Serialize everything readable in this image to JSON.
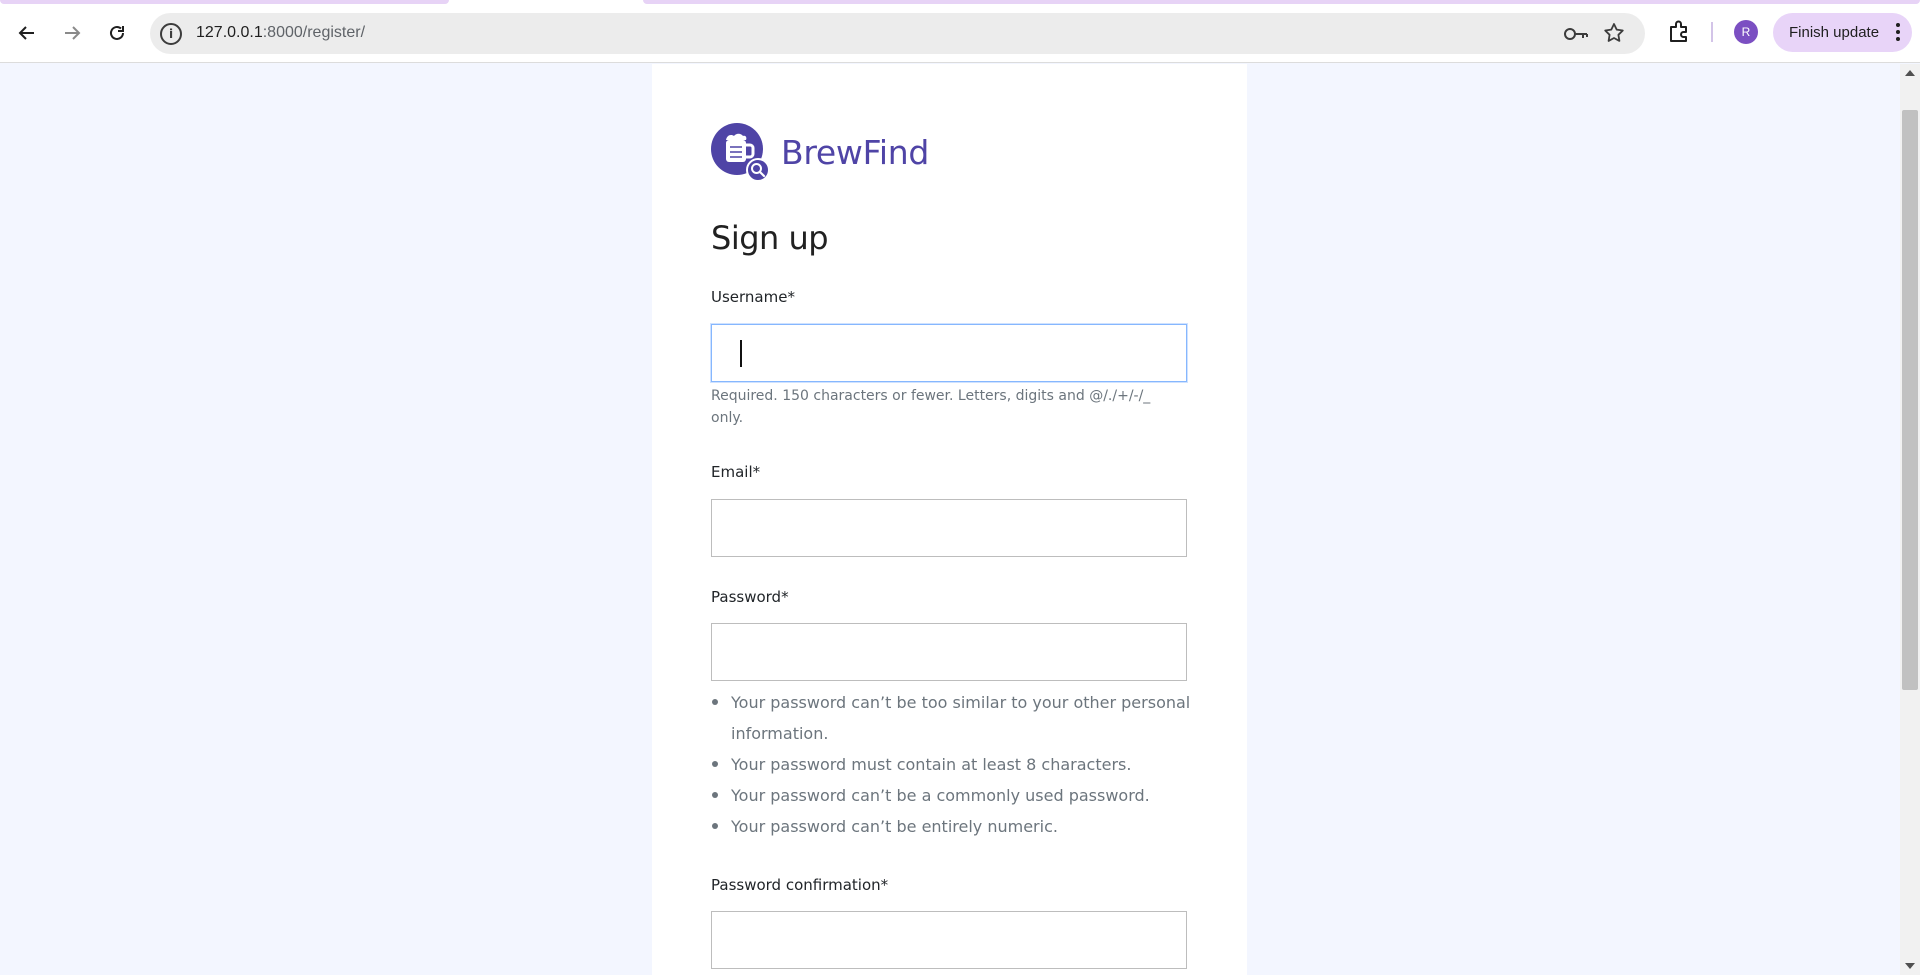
{
  "browser": {
    "url_host": "127.0.0.1",
    "url_path": ":8000/register/",
    "profile_initial": "R",
    "update_label": "Finish update",
    "icons": {
      "back": "back-arrow-icon",
      "forward": "forward-arrow-icon",
      "reload": "reload-icon",
      "site_info": "info-icon",
      "passwords": "key-icon",
      "bookmark": "star-icon",
      "extensions": "puzzle-icon",
      "menu": "kebab-menu-icon"
    }
  },
  "brand": {
    "name": "BrewFind",
    "color": "#4f44a6",
    "logo_icon": "beer-search-logo-icon"
  },
  "form": {
    "title": "Sign up",
    "username": {
      "label": "Username*",
      "value": "",
      "help": "Required. 150 characters or fewer. Letters, digits and @/./+/-/_ only."
    },
    "email": {
      "label": "Email*",
      "value": ""
    },
    "password": {
      "label": "Password*",
      "value": "",
      "rules": [
        "Your password can’t be too similar to your other personal information.",
        "Your password must contain at least 8 characters.",
        "Your password can’t be a commonly used password.",
        "Your password can’t be entirely numeric."
      ]
    },
    "password_confirmation": {
      "label": "Password confirmation*",
      "value": ""
    }
  },
  "colors": {
    "page_background": "#f3f6ff",
    "card_background": "#ffffff",
    "focus_border": "#86b7fe",
    "muted_text": "#6c757d"
  }
}
